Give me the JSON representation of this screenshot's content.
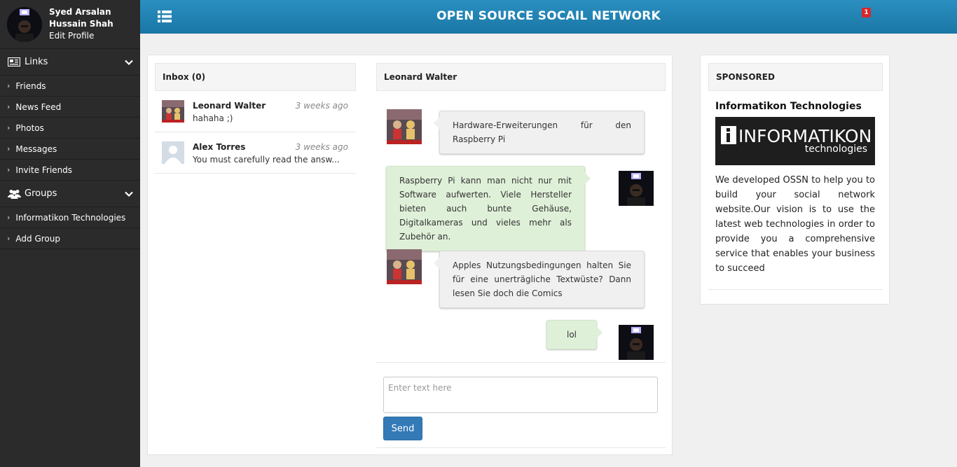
{
  "app": {
    "title": "OPEN SOURCE SOCAIL NETWORK"
  },
  "topbar": {
    "notification_count": "1"
  },
  "user": {
    "name": "Syed Arsalan Hussain Shah",
    "edit_profile": "Edit Profile"
  },
  "sidebar": {
    "links_section": {
      "label": "Links",
      "icon": "newspaper-icon"
    },
    "links": [
      {
        "label": "Friends"
      },
      {
        "label": "News Feed"
      },
      {
        "label": "Photos"
      },
      {
        "label": "Messages"
      },
      {
        "label": "Invite Friends"
      }
    ],
    "groups_section": {
      "label": "Groups",
      "icon": "users-icon"
    },
    "groups": [
      {
        "label": "Informatikon Technologies"
      },
      {
        "label": "Add Group"
      }
    ]
  },
  "inbox": {
    "title": "Inbox (0)",
    "items": [
      {
        "name": "Leonard Walter",
        "time": "3 weeks ago",
        "preview": "hahaha ;)"
      },
      {
        "name": "Alex Torres",
        "time": "3 weeks ago",
        "preview": "You must carefully read the answ..."
      }
    ]
  },
  "conversation": {
    "title": "Leonard Walter",
    "messages": [
      {
        "direction": "in",
        "text": "Hardware-Erweiterungen für den Raspberry Pi"
      },
      {
        "direction": "out",
        "text": "Raspberry Pi kann man nicht nur mit Software aufwerten. Viele Hersteller bieten auch bunte Gehäuse, Digitalkameras und vieles mehr als Zubehör an."
      },
      {
        "direction": "in",
        "text": "Apples Nutzungsbedingungen halten Sie für eine unerträgliche Textwüste? Dann lesen Sie doch die Comics"
      },
      {
        "direction": "out",
        "text": "lol"
      }
    ],
    "input_placeholder": "Enter text here",
    "send_label": "Send"
  },
  "sponsored": {
    "header": "SPONSORED",
    "title": "Informatikon Technologies",
    "logo_main": "INFORMATIKON",
    "logo_sub": "technologies",
    "text": "We developed OSSN to help you to build your social network website.Our vision is to use the latest web technologies in order to provide you a comprehensive service that enables your business to succeed"
  },
  "colors": {
    "topbar": "#1f82b3",
    "sidebar": "#2b2b2b",
    "bubble_out": "#dff0d8",
    "bubble_in": "#f0f0f0",
    "send_button": "#337ab7",
    "badge": "#d9262b"
  }
}
